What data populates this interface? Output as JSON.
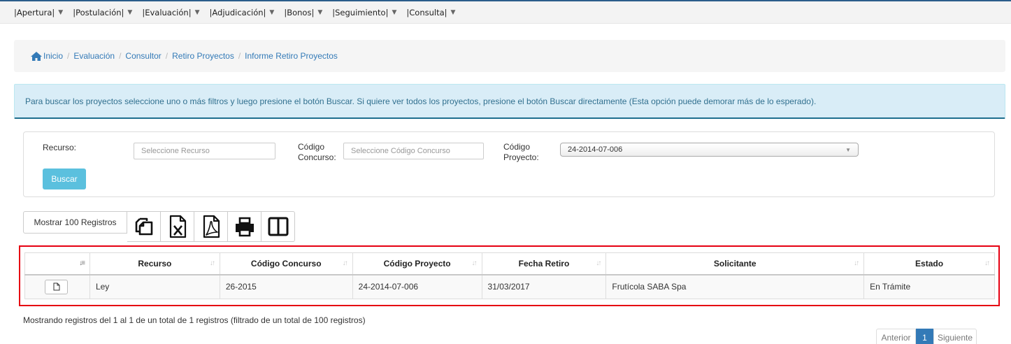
{
  "menu": {
    "items": [
      {
        "label": "|Apertura|"
      },
      {
        "label": "|Postulación|"
      },
      {
        "label": "|Evaluación|"
      },
      {
        "label": "|Adjudicación|"
      },
      {
        "label": "|Bonos|"
      },
      {
        "label": "|Seguimiento|"
      },
      {
        "label": "|Consulta|"
      }
    ]
  },
  "breadcrumb": {
    "items": [
      "Inicio",
      "Evaluación",
      "Consultor",
      "Retiro Proyectos",
      "Informe Retiro Proyectos"
    ]
  },
  "alert": {
    "text": "Para buscar los proyectos seleccione uno o más filtros y luego presione el botón Buscar. Si quiere ver todos los proyectos, presione el botón Buscar directamente (Esta opción puede demorar más de lo esperado)."
  },
  "filters": {
    "recurso_label": "Recurso:",
    "recurso_placeholder": "Seleccione Recurso",
    "codigo_concurso_label_1": "Código",
    "codigo_concurso_label_2": "Concurso:",
    "codigo_concurso_placeholder": "Seleccione Código Concurso",
    "codigo_proyecto_label_1": "Código",
    "codigo_proyecto_label_2": "Proyecto:",
    "codigo_proyecto_value": "24-2014-07-006",
    "buscar_label": "Buscar"
  },
  "toolbar": {
    "show_label": "Mostrar 100 Registros",
    "icons": [
      "copy-icon",
      "excel-icon",
      "pdf-icon",
      "print-icon",
      "columns-icon"
    ]
  },
  "table": {
    "columns": [
      "",
      "Recurso",
      "Código Concurso",
      "Código Proyecto",
      "Fecha Retiro",
      "Solicitante",
      "Estado"
    ],
    "rows": [
      {
        "recurso": "Ley",
        "codigo_concurso": "26-2015",
        "codigo_proyecto": "24-2014-07-006",
        "fecha_retiro": "31/03/2017",
        "solicitante": "Frutícola SABA Spa",
        "estado": "En Trámite"
      }
    ]
  },
  "info": {
    "text": "Mostrando registros del 1 al 1 de un total de 1 registros (filtrado de un total de 100 registros)"
  },
  "pagination": {
    "prev": "Anterior",
    "current": "1",
    "next": "Siguiente"
  },
  "colors": {
    "accent_blue": "#337ab7",
    "info_bg": "#d9edf7",
    "buscar_bg": "#5bc0de",
    "highlight_border": "#e60012"
  }
}
